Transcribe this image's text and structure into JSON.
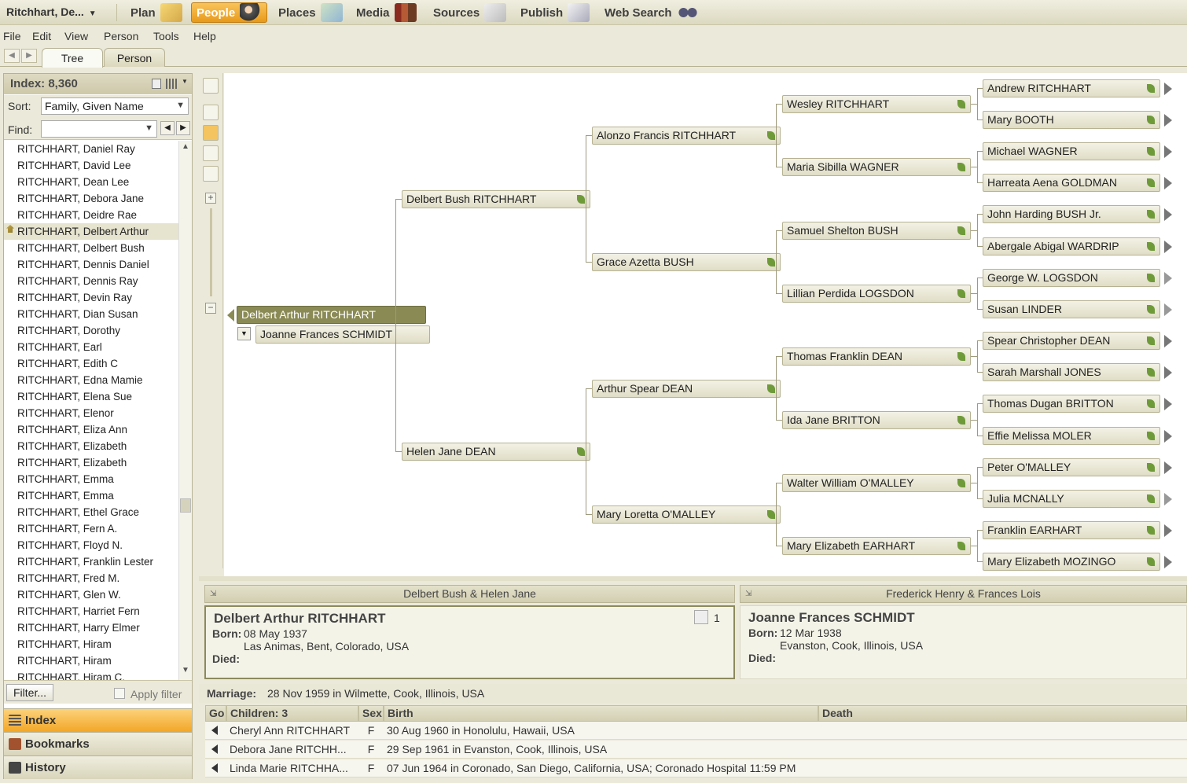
{
  "app": {
    "tree_name": "Ritchhart, De...",
    "dropdown_glyph": "▼"
  },
  "workspaces": [
    {
      "label": "Plan",
      "icon": "plan-icon",
      "active": false
    },
    {
      "label": "People",
      "icon": "people-icon",
      "active": true
    },
    {
      "label": "Places",
      "icon": "places-icon",
      "active": false
    },
    {
      "label": "Media",
      "icon": "media-icon",
      "active": false
    },
    {
      "label": "Sources",
      "icon": "sources-icon",
      "active": false
    },
    {
      "label": "Publish",
      "icon": "publish-icon",
      "active": false
    },
    {
      "label": "Web Search",
      "icon": "web-search-icon",
      "active": false
    }
  ],
  "menu": [
    "File",
    "Edit",
    "View",
    "Person",
    "Tools",
    "Help"
  ],
  "tabs": {
    "tree": "Tree",
    "person": "Person",
    "active": "Tree"
  },
  "index": {
    "title": "Index: 8,360",
    "sort_label": "Sort:",
    "sort_value": "Family, Given Name",
    "find_label": "Find:",
    "find_value": "",
    "names": [
      "RITCHHART, Daniel Ray",
      "RITCHHART, David Lee",
      "RITCHHART, Dean Lee",
      "RITCHHART, Debora Jane",
      "RITCHHART, Deidre Rae",
      "RITCHHART, Delbert Arthur",
      "RITCHHART, Delbert Bush",
      "RITCHHART, Dennis Daniel",
      "RITCHHART, Dennis Ray",
      "RITCHHART, Devin Ray",
      "RITCHHART, Dian Susan",
      "RITCHHART, Dorothy",
      "RITCHHART, Earl",
      "RITCHHART, Edith C",
      "RITCHHART, Edna Mamie",
      "RITCHHART, Elena Sue",
      "RITCHHART, Elenor",
      "RITCHHART, Eliza Ann",
      "RITCHHART, Elizabeth",
      "RITCHHART, Elizabeth",
      "RITCHHART, Emma",
      "RITCHHART, Emma",
      "RITCHHART, Ethel Grace",
      "RITCHHART, Fern A.",
      "RITCHHART, Floyd N.",
      "RITCHHART, Franklin Lester",
      "RITCHHART, Fred M.",
      "RITCHHART, Glen W.",
      "RITCHHART, Harriet Fern",
      "RITCHHART, Harry Elmer",
      "RITCHHART, Hiram",
      "RITCHHART, Hiram",
      "RITCHHART, Hiram C."
    ],
    "selected_name": "RITCHHART, Delbert Arthur",
    "filter_label": "Filter...",
    "apply_filter_label": "Apply filter"
  },
  "leftnav": {
    "index": "Index",
    "bookmarks": "Bookmarks",
    "history": "History",
    "active": "Index"
  },
  "pedigree": {
    "root": "Delbert Arthur RITCHHART",
    "spouse": "Joanne Frances SCHMIDT",
    "gen1": [
      "Delbert Bush RITCHHART",
      "Helen Jane DEAN"
    ],
    "gen2": [
      "Alonzo Francis RITCHHART",
      "Grace Azetta BUSH",
      "Arthur Spear DEAN",
      "Mary Loretta O'MALLEY"
    ],
    "gen3": [
      "Wesley RITCHHART",
      "Maria Sibilla WAGNER",
      "Samuel Shelton BUSH",
      "Lillian Perdida LOGSDON",
      "Thomas Franklin DEAN",
      "Ida Jane BRITTON",
      "Walter William O'MALLEY",
      "Mary Elizabeth EARHART"
    ],
    "gen4": [
      "Andrew RITCHHART",
      "Mary BOOTH",
      "Michael WAGNER",
      "Harreata Aena GOLDMAN",
      "John Harding BUSH Jr.",
      "Abergale Abigal WARDRIP",
      "George W. LOGSDON",
      "Susan LINDER",
      "Spear Christopher DEAN",
      "Sarah Marshall JONES",
      "Thomas Dugan BRITTON",
      "Effie Melissa MOLER",
      "Peter O'MALLEY",
      "Julia MCNALLY",
      "Franklin EARHART",
      "Mary Elizabeth MOZINGO"
    ],
    "gen4_more_hollow": [
      false,
      false,
      false,
      false,
      false,
      false,
      true,
      true,
      false,
      false,
      false,
      false,
      false,
      true,
      false,
      false
    ]
  },
  "family": {
    "husband_parents": "Delbert Bush & Helen Jane",
    "wife_parents": "Frederick Henry & Frances Lois",
    "husband": {
      "name": "Delbert Arthur RITCHHART",
      "born_label": "Born:",
      "born_date": "08 May 1937",
      "born_place": "Las Animas, Bent, Colorado, USA",
      "died_label": "Died:",
      "media_count": "1"
    },
    "wife": {
      "name": "Joanne Frances SCHMIDT",
      "born_label": "Born:",
      "born_date": "12 Mar 1938",
      "born_place": "Evanston, Cook, Illinois, USA",
      "died_label": "Died:"
    },
    "marriage_label": "Marriage:",
    "marriage_value": "28 Nov 1959 in Wilmette, Cook, Illinois, USA",
    "children_headers": {
      "go": "Go",
      "children": "Children: 3",
      "sex": "Sex",
      "birth": "Birth",
      "death": "Death"
    },
    "children": [
      {
        "name": "Cheryl Ann RITCHHART",
        "sex": "F",
        "birth": "30 Aug 1960 in Honolulu, Hawaii, USA",
        "death": ""
      },
      {
        "name": "Debora Jane RITCHH...",
        "sex": "F",
        "birth": "29 Sep 1961 in Evanston, Cook, Illinois, USA",
        "death": ""
      },
      {
        "name": "Linda Marie RITCHHA...",
        "sex": "F",
        "birth": "07 Jun 1964 in Coronado, San Diego, California, USA; Coronado Hospital 11:59 PM",
        "death": ""
      }
    ]
  },
  "colors": {
    "accent": "#f2a627",
    "root_box": "#8a8a55",
    "leaf": "#6f9a3a"
  }
}
